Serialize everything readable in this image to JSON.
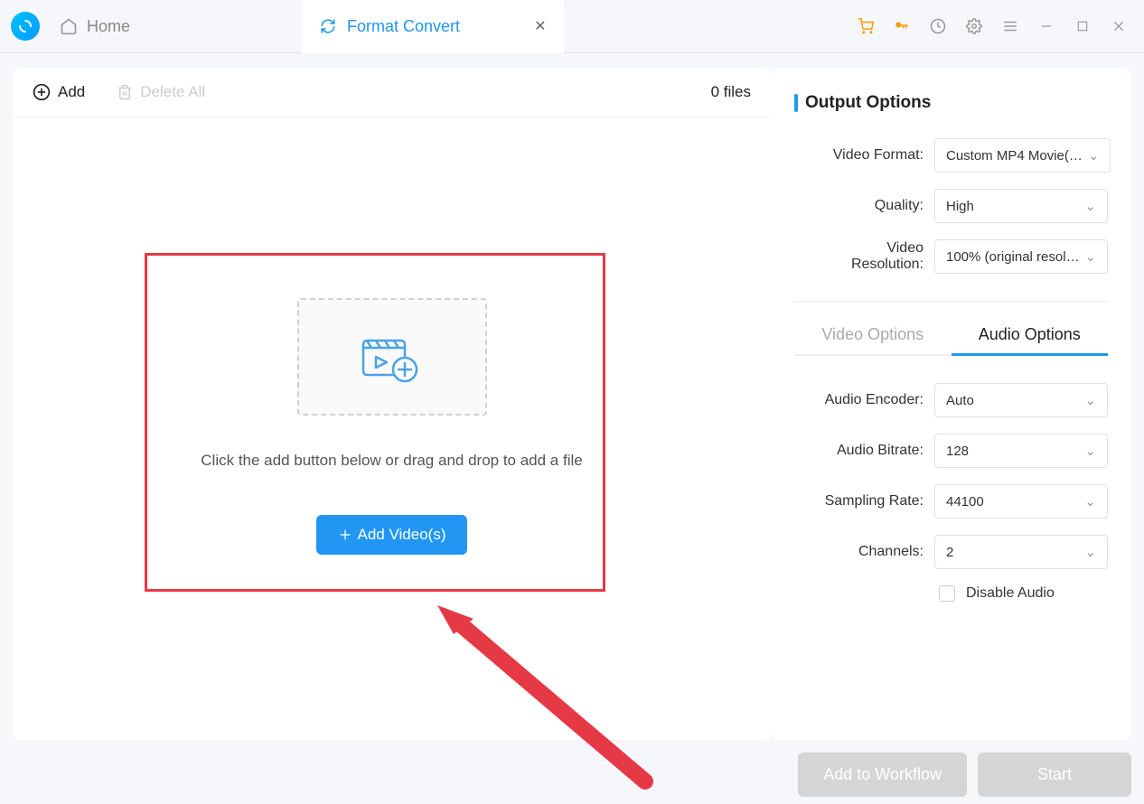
{
  "header": {
    "home_label": "Home",
    "active_tab_label": "Format Convert"
  },
  "toolbar": {
    "add_label": "Add",
    "delete_label": "Delete All",
    "file_count": "0 files"
  },
  "drop": {
    "hint": "Click the add button below or drag and drop to add a file",
    "add_button": "Add Video(s)"
  },
  "output": {
    "section_title": "Output Options",
    "video_format_label": "Video Format:",
    "video_format_value": "Custom MP4 Movie(…",
    "quality_label": "Quality:",
    "quality_value": "High",
    "resolution_label": "Video Resolution:",
    "resolution_value": "100% (original resol…"
  },
  "subtabs": {
    "video": "Video Options",
    "audio": "Audio Options"
  },
  "audio": {
    "encoder_label": "Audio Encoder:",
    "encoder_value": "Auto",
    "bitrate_label": "Audio Bitrate:",
    "bitrate_value": "128",
    "sampling_label": "Sampling Rate:",
    "sampling_value": "44100",
    "channels_label": "Channels:",
    "channels_value": "2",
    "disable_label": "Disable Audio"
  },
  "footer": {
    "workflow": "Add to Workflow",
    "start": "Start"
  }
}
